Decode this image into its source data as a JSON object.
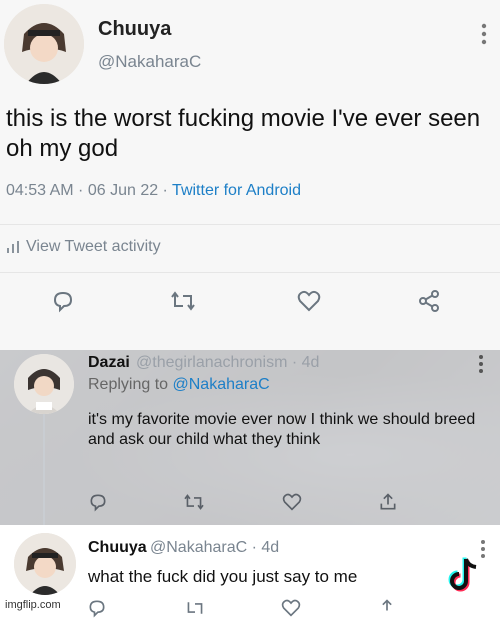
{
  "tweet": {
    "name": "Chuuya",
    "handle": "@NakaharaC",
    "text": "this is the worst fucking movie I've ever seen oh my god",
    "time": "04:53 AM",
    "date": "06 Jun 22",
    "sep": " · ",
    "client": "Twitter for Android",
    "activity_label": "View Tweet activity"
  },
  "reply1": {
    "name": "Dazai",
    "handle": "@thegirlanachronism",
    "age": "· 4d",
    "replying_prefix": "Replying to",
    "replying_to": "@NakaharaC",
    "text": "it's my favorite movie ever now I think we should breed and ask our child what they think"
  },
  "reply2": {
    "name": "Chuuya",
    "handle": "@NakaharaC",
    "age": "· 4d",
    "text": "what the fuck did you just say to me"
  },
  "watermark": "imgflip.com",
  "colors": {
    "link_blue": "#1d7fc7",
    "muted_gray": "#7a8590"
  },
  "icons": [
    "more-icon",
    "reply-icon",
    "retweet-icon",
    "like-icon",
    "share-icon",
    "analytics-icon",
    "tiktok-logo-icon"
  ]
}
